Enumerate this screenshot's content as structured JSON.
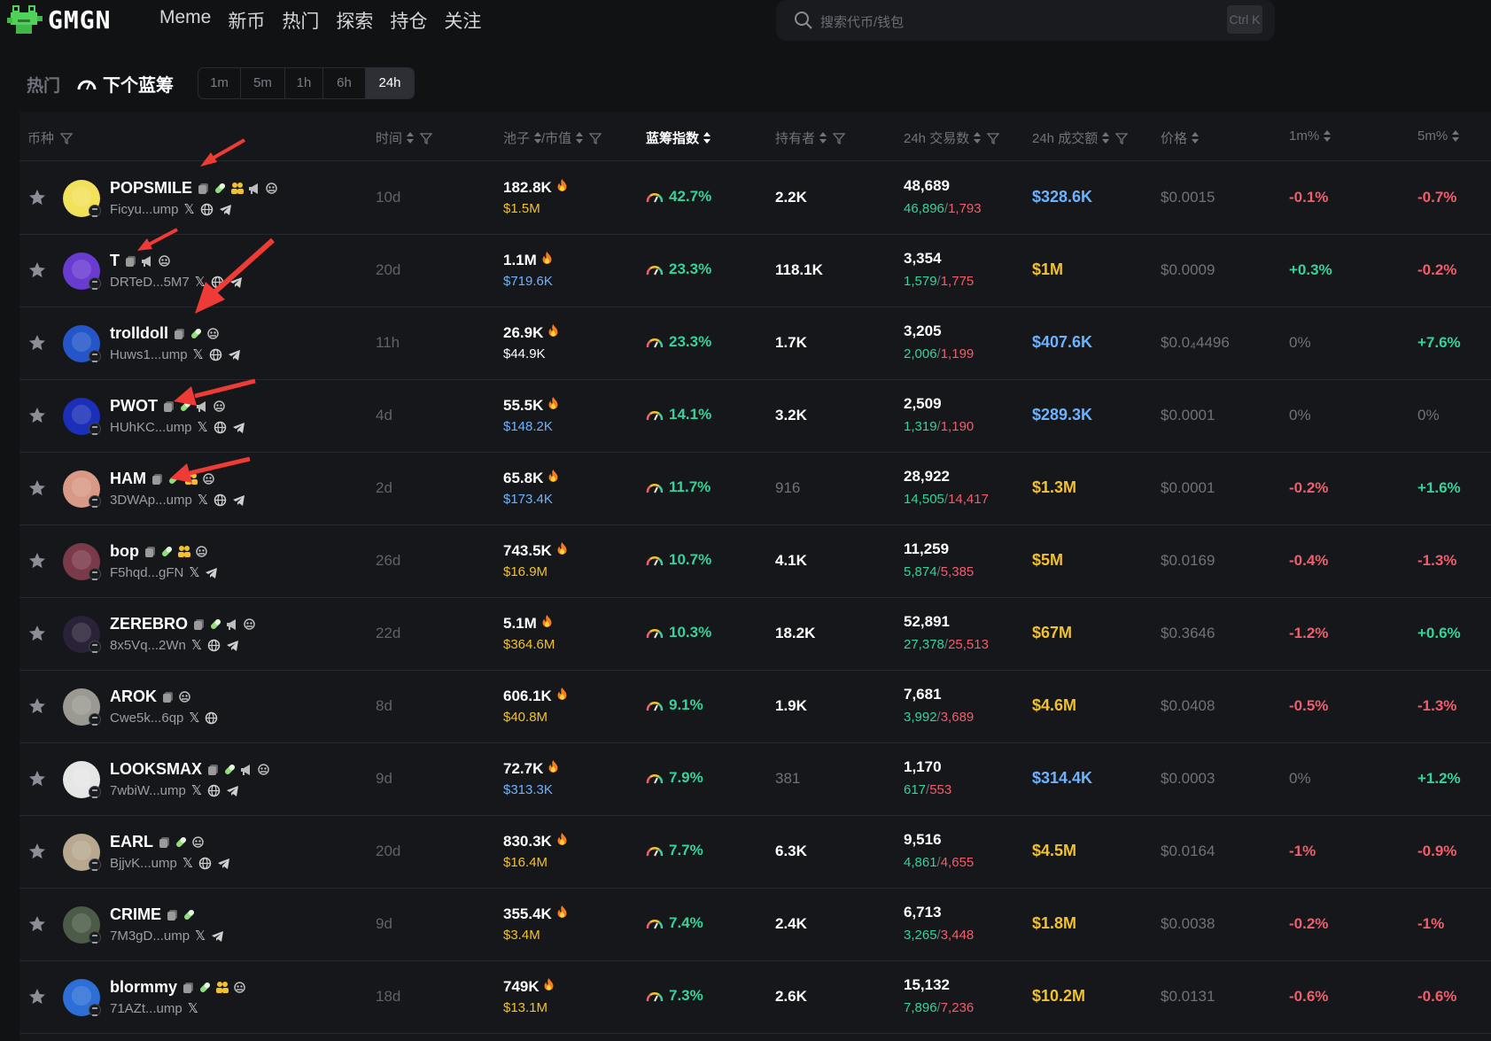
{
  "app": {
    "logo_text": "GMGN"
  },
  "nav": {
    "items": [
      "Meme",
      "新币",
      "热门",
      "探索",
      "持仓",
      "关注"
    ]
  },
  "search": {
    "placeholder": "搜索代币/钱包",
    "shortcut": "Ctrl K"
  },
  "subbar": {
    "hot": "热门",
    "next_bluechip": "下个蓝筹",
    "timeframes": [
      "1m",
      "5m",
      "1h",
      "6h",
      "24h"
    ],
    "active_timeframe": "24h"
  },
  "columns": {
    "coin": "币种",
    "age": "时间",
    "pool": "池子",
    "mcap": "/市值",
    "bluechip": "蓝筹指数",
    "holders": "持有者",
    "tx24": "24h 交易数",
    "vol24": "24h 成交额",
    "price": "价格",
    "m1": "1m%",
    "m5": "5m%"
  },
  "colors": {
    "green": "#36d399",
    "red": "#f25d6d",
    "yellow": "#f2c12e",
    "blue": "#6cb3ff",
    "dim": "#6f727a",
    "accent_arrow": "#ef3b36"
  },
  "rows": [
    {
      "name": "POPSMILE",
      "addr": "Ficyu...ump",
      "age": "10d",
      "pool": "182.8K",
      "mcap": "$1.5M",
      "mcap_color": "yellow",
      "chip": "42.7%",
      "holders": "2.2K",
      "holders_dim": false,
      "tx": "48,689",
      "buys": "46,896",
      "sells": "1,793",
      "vol": "$328.6K",
      "vol_color": "blue",
      "price": "$0.0015",
      "m1": "-0.1%",
      "m1_color": "red",
      "m5": "-0.7%",
      "m5_color": "red",
      "icons": [
        "copy",
        "pill",
        "users",
        "horn",
        "bot"
      ],
      "socials": [
        "X",
        "web",
        "tg"
      ],
      "avatar": "#f2e15a"
    },
    {
      "name": "T",
      "addr": "DRTeD...5M7",
      "age": "20d",
      "pool": "1.1M",
      "mcap": "$719.6K",
      "mcap_color": "blue",
      "chip": "23.3%",
      "holders": "118.1K",
      "holders_dim": false,
      "tx": "3,354",
      "buys": "1,579",
      "sells": "1,775",
      "vol": "$1M",
      "vol_color": "yellow",
      "price": "$0.0009",
      "m1": "+0.3%",
      "m1_color": "green",
      "m5": "-0.2%",
      "m5_color": "red",
      "icons": [
        "copy",
        "horn",
        "bot"
      ],
      "socials": [
        "X",
        "web",
        "tg"
      ],
      "avatar": "#6a3bd1"
    },
    {
      "name": "trolldoll",
      "addr": "Huws1...ump",
      "age": "11h",
      "pool": "26.9K",
      "mcap": "$44.9K",
      "mcap_color": "white",
      "chip": "23.3%",
      "holders": "1.7K",
      "holders_dim": false,
      "tx": "3,205",
      "buys": "2,006",
      "sells": "1,199",
      "vol": "$407.6K",
      "vol_color": "blue",
      "price": "$0.0₄4496",
      "m1": "0%",
      "m1_color": "dim",
      "m5": "+7.6%",
      "m5_color": "green",
      "icons": [
        "copy",
        "pill",
        "bot"
      ],
      "socials": [
        "X",
        "web",
        "tg"
      ],
      "avatar": "#2456c9"
    },
    {
      "name": "PWOT",
      "addr": "HUhKC...ump",
      "age": "4d",
      "pool": "55.5K",
      "mcap": "$148.2K",
      "mcap_color": "blue",
      "chip": "14.1%",
      "holders": "3.2K",
      "holders_dim": false,
      "tx": "2,509",
      "buys": "1,319",
      "sells": "1,190",
      "vol": "$289.3K",
      "vol_color": "blue",
      "price": "$0.0001",
      "m1": "0%",
      "m1_color": "dim",
      "m5": "0%",
      "m5_color": "dim",
      "icons": [
        "copy",
        "pill",
        "horn",
        "bot"
      ],
      "socials": [
        "X",
        "web",
        "tg"
      ],
      "avatar": "#1b2fb8"
    },
    {
      "name": "HAM",
      "addr": "3DWAp...ump",
      "age": "2d",
      "pool": "65.8K",
      "mcap": "$173.4K",
      "mcap_color": "blue",
      "chip": "11.7%",
      "holders": "916",
      "holders_dim": true,
      "tx": "28,922",
      "buys": "14,505",
      "sells": "14,417",
      "vol": "$1.3M",
      "vol_color": "yellow",
      "price": "$0.0001",
      "m1": "-0.2%",
      "m1_color": "red",
      "m5": "+1.6%",
      "m5_color": "green",
      "icons": [
        "copy",
        "pill",
        "users",
        "bot"
      ],
      "socials": [
        "X",
        "web",
        "tg"
      ],
      "avatar": "#d89a86"
    },
    {
      "name": "bop",
      "addr": "F5hqd...gFN",
      "age": "26d",
      "pool": "743.5K",
      "mcap": "$16.9M",
      "mcap_color": "yellow",
      "chip": "10.7%",
      "holders": "4.1K",
      "holders_dim": false,
      "tx": "11,259",
      "buys": "5,874",
      "sells": "5,385",
      "vol": "$5M",
      "vol_color": "yellow",
      "price": "$0.0169",
      "m1": "-0.4%",
      "m1_color": "red",
      "m5": "-1.3%",
      "m5_color": "red",
      "icons": [
        "copy",
        "pill",
        "users",
        "bot"
      ],
      "socials": [
        "X",
        "tg"
      ],
      "avatar": "#7a3a4a"
    },
    {
      "name": "ZEREBRO",
      "addr": "8x5Vq...2Wn",
      "age": "22d",
      "pool": "5.1M",
      "mcap": "$364.6M",
      "mcap_color": "yellow",
      "chip": "10.3%",
      "holders": "18.2K",
      "holders_dim": false,
      "tx": "52,891",
      "buys": "27,378",
      "sells": "25,513",
      "vol": "$67M",
      "vol_color": "yellow",
      "price": "$0.3646",
      "m1": "-1.2%",
      "m1_color": "red",
      "m5": "+0.6%",
      "m5_color": "green",
      "icons": [
        "copy",
        "pill",
        "horn",
        "bot"
      ],
      "socials": [
        "X",
        "web",
        "tg"
      ],
      "avatar": "#2a2238"
    },
    {
      "name": "AROK",
      "addr": "Cwe5k...6qp",
      "age": "8d",
      "pool": "606.1K",
      "mcap": "$40.8M",
      "mcap_color": "yellow",
      "chip": "9.1%",
      "holders": "1.9K",
      "holders_dim": false,
      "tx": "7,681",
      "buys": "3,992",
      "sells": "3,689",
      "vol": "$4.6M",
      "vol_color": "yellow",
      "price": "$0.0408",
      "m1": "-0.5%",
      "m1_color": "red",
      "m5": "-1.3%",
      "m5_color": "red",
      "icons": [
        "copy",
        "bot"
      ],
      "socials": [
        "X",
        "web"
      ],
      "avatar": "#9a9a92"
    },
    {
      "name": "LOOKSMAX",
      "addr": "7wbiW...ump",
      "age": "9d",
      "pool": "72.7K",
      "mcap": "$313.3K",
      "mcap_color": "blue",
      "chip": "7.9%",
      "holders": "381",
      "holders_dim": true,
      "tx": "1,170",
      "buys": "617",
      "sells": "553",
      "vol": "$314.4K",
      "vol_color": "blue",
      "price": "$0.0003",
      "m1": "0%",
      "m1_color": "dim",
      "m5": "+1.2%",
      "m5_color": "green",
      "icons": [
        "copy",
        "pill",
        "horn",
        "bot"
      ],
      "socials": [
        "X",
        "web",
        "tg"
      ],
      "avatar": "#e6e6e6"
    },
    {
      "name": "EARL",
      "addr": "BjjvK...ump",
      "age": "20d",
      "pool": "830.3K",
      "mcap": "$16.4M",
      "mcap_color": "yellow",
      "chip": "7.7%",
      "holders": "6.3K",
      "holders_dim": false,
      "tx": "9,516",
      "buys": "4,861",
      "sells": "4,655",
      "vol": "$4.5M",
      "vol_color": "yellow",
      "price": "$0.0164",
      "m1": "-1%",
      "m1_color": "red",
      "m5": "-0.9%",
      "m5_color": "red",
      "icons": [
        "copy",
        "pill",
        "bot"
      ],
      "socials": [
        "X",
        "web",
        "tg"
      ],
      "avatar": "#b8a890"
    },
    {
      "name": "CRIME",
      "addr": "7M3gD...ump",
      "age": "9d",
      "pool": "355.4K",
      "mcap": "$3.4M",
      "mcap_color": "yellow",
      "chip": "7.4%",
      "holders": "2.4K",
      "holders_dim": false,
      "tx": "6,713",
      "buys": "3,265",
      "sells": "3,448",
      "vol": "$1.8M",
      "vol_color": "yellow",
      "price": "$0.0038",
      "m1": "-0.2%",
      "m1_color": "red",
      "m5": "-1%",
      "m5_color": "red",
      "icons": [
        "copy",
        "pill"
      ],
      "socials": [
        "X",
        "tg"
      ],
      "avatar": "#4c5a48"
    },
    {
      "name": "blormmy",
      "addr": "71AZt...ump",
      "age": "18d",
      "pool": "749K",
      "mcap": "$13.1M",
      "mcap_color": "yellow",
      "chip": "7.3%",
      "holders": "2.6K",
      "holders_dim": false,
      "tx": "15,132",
      "buys": "7,896",
      "sells": "7,236",
      "vol": "$10.2M",
      "vol_color": "yellow",
      "price": "$0.0131",
      "m1": "-0.6%",
      "m1_color": "red",
      "m5": "-0.6%",
      "m5_color": "red",
      "icons": [
        "copy",
        "pill",
        "users",
        "bot"
      ],
      "socials": [
        "X"
      ],
      "avatar": "#2d6fd6"
    }
  ]
}
